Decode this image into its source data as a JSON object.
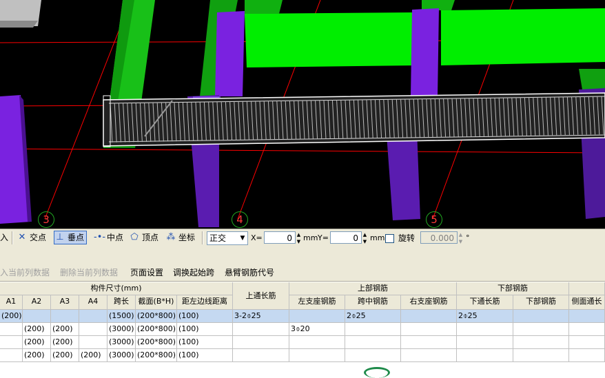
{
  "viewport": {
    "axis_labels": [
      "3",
      "4",
      "5"
    ],
    "colors": {
      "background": "#000000",
      "beam_green": "#00dd00",
      "column_purple": "#6e22c8",
      "grid_red": "#ff0000",
      "selected_beam": "#ffffff"
    }
  },
  "snap_toolbar": {
    "left_cut": "入",
    "intersection": "交点",
    "perpendicular": "垂点",
    "midpoint": "中点",
    "vertex": "顶点",
    "coordinate": "坐标",
    "ortho_mode": "正交",
    "x_label": "X=",
    "x_value": "0",
    "x_unit": "mm",
    "y_label": "Y=",
    "y_value": "0",
    "y_unit": "mm",
    "rotate_label": "旋转",
    "rotate_value": "0.000",
    "rotate_unit": "°"
  },
  "table_toolbar": {
    "insert_col": "入当前列数据",
    "delete_col": "删除当前列数据",
    "page_setup": "页面设置",
    "swap_start": "调换起始跨",
    "cantilever_code": "悬臂钢筋代号"
  },
  "grid": {
    "group_headers": {
      "dims": "构件尺寸(mm)",
      "top_rebar": "上部钢筋",
      "bottom_rebar": "下部钢筋"
    },
    "columns": [
      "A1",
      "A2",
      "A3",
      "A4",
      "跨长",
      "截面(B*H)",
      "距左边线距离",
      "上通长筋",
      "左支座钢筋",
      "跨中钢筋",
      "右支座钢筋",
      "下通长筋",
      "下部钢筋",
      "侧面通长"
    ],
    "rows": [
      [
        "(200)",
        "",
        "",
        "",
        "(1500)",
        "(200*800)",
        "(100)",
        "3-2⌽25",
        "",
        "2⌽25",
        "",
        "2⌽25",
        "",
        ""
      ],
      [
        "",
        "(200)",
        "(200)",
        "",
        "(3000)",
        "(200*800)",
        "(100)",
        "",
        "3⌽20",
        "",
        "",
        "",
        "",
        ""
      ],
      [
        "",
        "(200)",
        "(200)",
        "",
        "(3000)",
        "(200*800)",
        "(100)",
        "",
        "",
        "",
        "",
        "",
        "",
        ""
      ],
      [
        "",
        "(200)",
        "(200)",
        "(200)",
        "(3000)",
        "(200*800)",
        "(100)",
        "",
        "",
        "",
        "",
        "",
        "",
        ""
      ]
    ]
  }
}
